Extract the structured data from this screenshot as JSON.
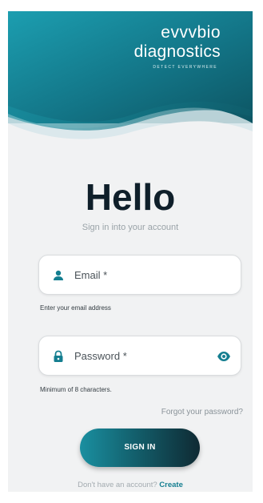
{
  "brand": {
    "logo_line1": "evvvbio",
    "logo_line2": "diagnostics",
    "tagline": "DETECT EVERYWHERE"
  },
  "page": {
    "title": "Hello",
    "subtitle": "Sign in into your account"
  },
  "email": {
    "placeholder": "Email *",
    "helper": "Enter your email address",
    "icon": "person-icon"
  },
  "password": {
    "placeholder": "Password *",
    "helper": "Minimum of 8 characters.",
    "icon": "lock-icon",
    "toggle_icon": "eye-icon"
  },
  "links": {
    "forgot": "Forgot your password?",
    "no_account": "Don't have an account?",
    "create": "Create"
  },
  "actions": {
    "signin": "SIGN IN"
  },
  "colors": {
    "brand_teal": "#147e90",
    "brand_dark": "#0f2a33",
    "background": "#f1f2f3"
  }
}
